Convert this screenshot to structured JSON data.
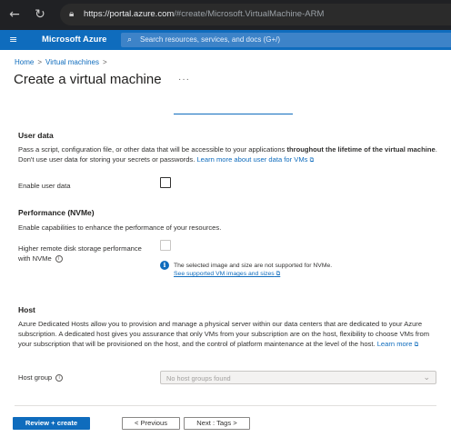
{
  "browser": {
    "url_host": "https://portal.azure.com",
    "url_path": "/#create/Microsoft.VirtualMachine-ARM"
  },
  "topbar": {
    "brand": "Microsoft Azure",
    "search_placeholder": "Search resources, services, and docs (G+/)"
  },
  "breadcrumb": {
    "home": "Home",
    "virtual_machines": "Virtual machines",
    "separator": ">"
  },
  "page": {
    "title": "Create a virtual machine",
    "more": "···"
  },
  "user_data": {
    "heading": "User data",
    "description_1": "Pass a script, configuration file, or other data that will be accessible to your applications ",
    "description_bold": "throughout the lifetime of the virtual machine",
    "description_2": ". Don't use user data for storing your secrets or passwords. ",
    "learn_more": "Learn more about user data for VMs",
    "enable_label": "Enable user data",
    "enabled": false
  },
  "performance": {
    "heading": "Performance (NVMe)",
    "description": "Enable capabilities to enhance the performance of your resources.",
    "nvme_label": "Higher remote disk storage performance with NVMe",
    "nvme_enabled": false,
    "note": "The selected image and size are not supported for NVMe.",
    "note_link": "See supported VM images and sizes"
  },
  "host": {
    "heading": "Host",
    "description": "Azure Dedicated Hosts allow you to provision and manage a physical server within our data centers that are dedicated to your Azure subscription. A dedicated host gives you assurance that only VMs from your subscription are on the host, flexibility to choose VMs from your subscription that will be provisioned on the host, and the control of platform maintenance at the level of the host. ",
    "learn_more": "Learn more",
    "host_group_label": "Host group",
    "host_group_value": "No host groups found"
  },
  "footer": {
    "review_create": "Review + create",
    "previous": "< Previous",
    "next": "Next : Tags >"
  },
  "colors": {
    "accent": "#0f6cbd",
    "chrome": "#202124"
  }
}
